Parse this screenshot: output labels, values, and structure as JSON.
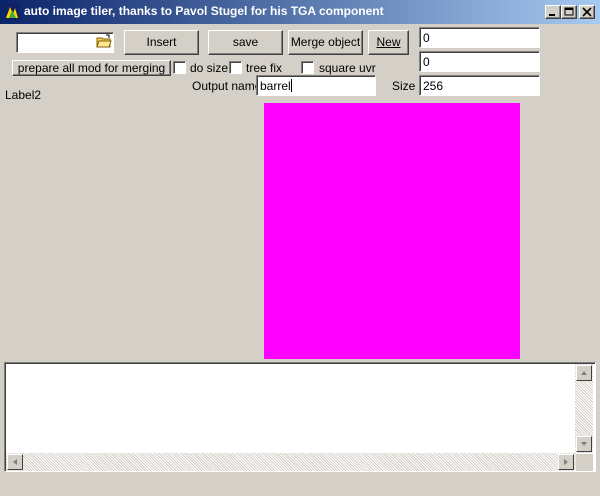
{
  "window": {
    "title": "auto image tiler, thanks to Pavol Stugel for his TGA component"
  },
  "toolbar": {
    "combo_value": "",
    "insert_label": "Insert",
    "save_label": "save",
    "merge_object_label": "Merge object",
    "new_label": "New",
    "prepare_label": "prepare all mod for merging"
  },
  "options": {
    "do_size_label": "do size",
    "tree_fix_label": "tree fix",
    "square_uvr_label": "square uvr"
  },
  "fields": {
    "value1": "0",
    "value2": "0",
    "output_name_label": "Output name",
    "output_name_value": "barrel",
    "size_label": "Size",
    "size_value": "256"
  },
  "status": {
    "label2": "Label2"
  },
  "preview": {
    "color": "#ff00ff"
  },
  "log": {
    "text": ""
  }
}
